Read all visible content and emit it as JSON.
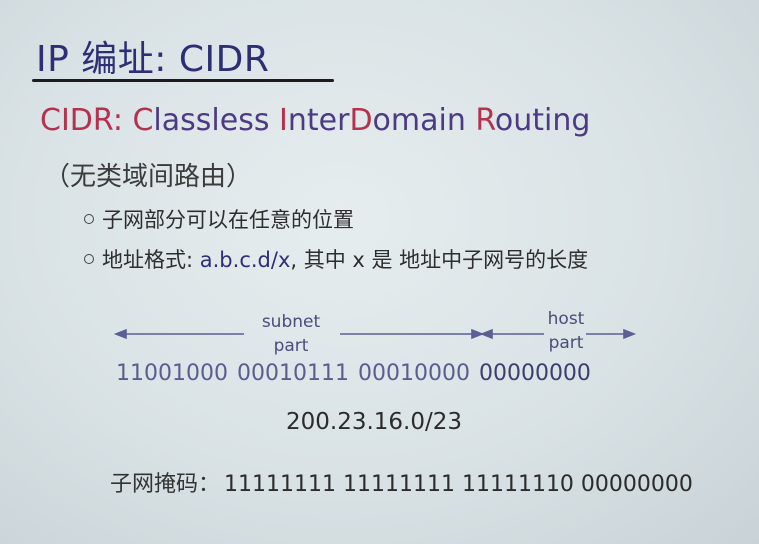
{
  "title": "IP 编址: CIDR",
  "subtitle": {
    "p1": "CIDR: C",
    "p2": "lassless ",
    "p3": "I",
    "p4": "nter",
    "p5": "D",
    "p6": "omain ",
    "p7": "R",
    "p8": "outing"
  },
  "paren_note": "（无类域间路由）",
  "bullets": {
    "b1": "子网部分可以在任意的位置",
    "b2_prefix": "地址格式: ",
    "b2_format": "a.b.c.d/x",
    "b2_suffix": ", 其中 x 是 地址中子网号的长度"
  },
  "diagram": {
    "subnet_label_1": "subnet",
    "subnet_label_2": "part",
    "host_label_1": "host",
    "host_label_2": "part",
    "octets": [
      "11001000",
      "00010111",
      "00010000",
      "00000000"
    ],
    "address": "200.23.16.0/23",
    "mask_label": "子网掩码：",
    "mask_value": "11111111 11111111 11111110 00000000"
  }
}
